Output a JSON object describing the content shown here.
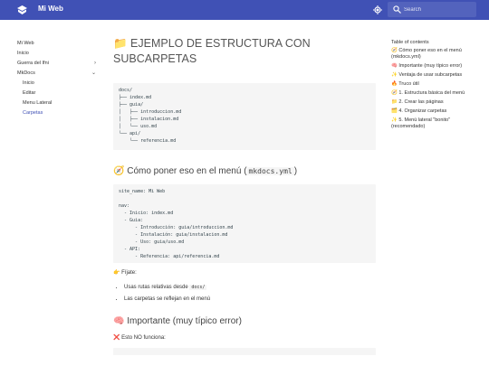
{
  "header": {
    "site_name": "Mi Web",
    "search_placeholder": "Search",
    "bg_color": "#4051b5"
  },
  "nav": {
    "items": [
      {
        "label": "Mi Web"
      },
      {
        "label": "Inicio"
      },
      {
        "label": "Guerra del Ifni",
        "chevron": "›"
      },
      {
        "label": "MkDocs",
        "chevron": "⌄"
      }
    ],
    "sub_items": [
      {
        "label": "Inicio"
      },
      {
        "label": "Editar"
      },
      {
        "label": "Menu Lateral"
      },
      {
        "label": "Carpetas",
        "active": true
      }
    ]
  },
  "main": {
    "title": "📁 EJEMPLO DE ESTRUCTURA CON SUBCARPETAS",
    "tree_code": "docs/\n├── index.md\n├── guia/\n│   ├── introduccion.md\n│   ├── instalacion.md\n│   └── uso.md\n└── api/\n    └── referencia.md",
    "section1_prefix": "🧭 Cómo poner eso en el menú (",
    "section1_code": "mkdocs.yml",
    "section1_suffix": ")",
    "yaml_code": "site_name: Mi Web\n\nnav:\n  - Inicio: index.md\n  - Guia:\n      - Introducción: guia/introduccion.md\n      - Instalación: guia/instalacion.md\n      - Uso: guia/uso.md\n  - API:\n      - Referencia: api/referencia.md",
    "fijate": "👉 Fíjate:",
    "bullet1_text": "Usas rutas relativas desde ",
    "bullet1_code": "docs/",
    "bullet2_text": "Las carpetas se reflejan en el menú",
    "section2_title": "🧠 Importante (muy típico error)",
    "no_funciona": "❌ Esto NO funciona:"
  },
  "toc": {
    "title": "Table of contents",
    "items": [
      "🧭 Cómo poner eso en el menú (mkdocs.yml)",
      "🧠 Importante (muy típico error)",
      "✨ Ventaja de usar subcarpetas",
      "🔥 Truco útil",
      "🧭 1. Estructura básica del menú",
      "📁 2. Crear las páginas",
      "🗂️ 4. Organizar carpetas",
      "✨ 5. Menú lateral \"bonito\" (recomendado)"
    ]
  }
}
